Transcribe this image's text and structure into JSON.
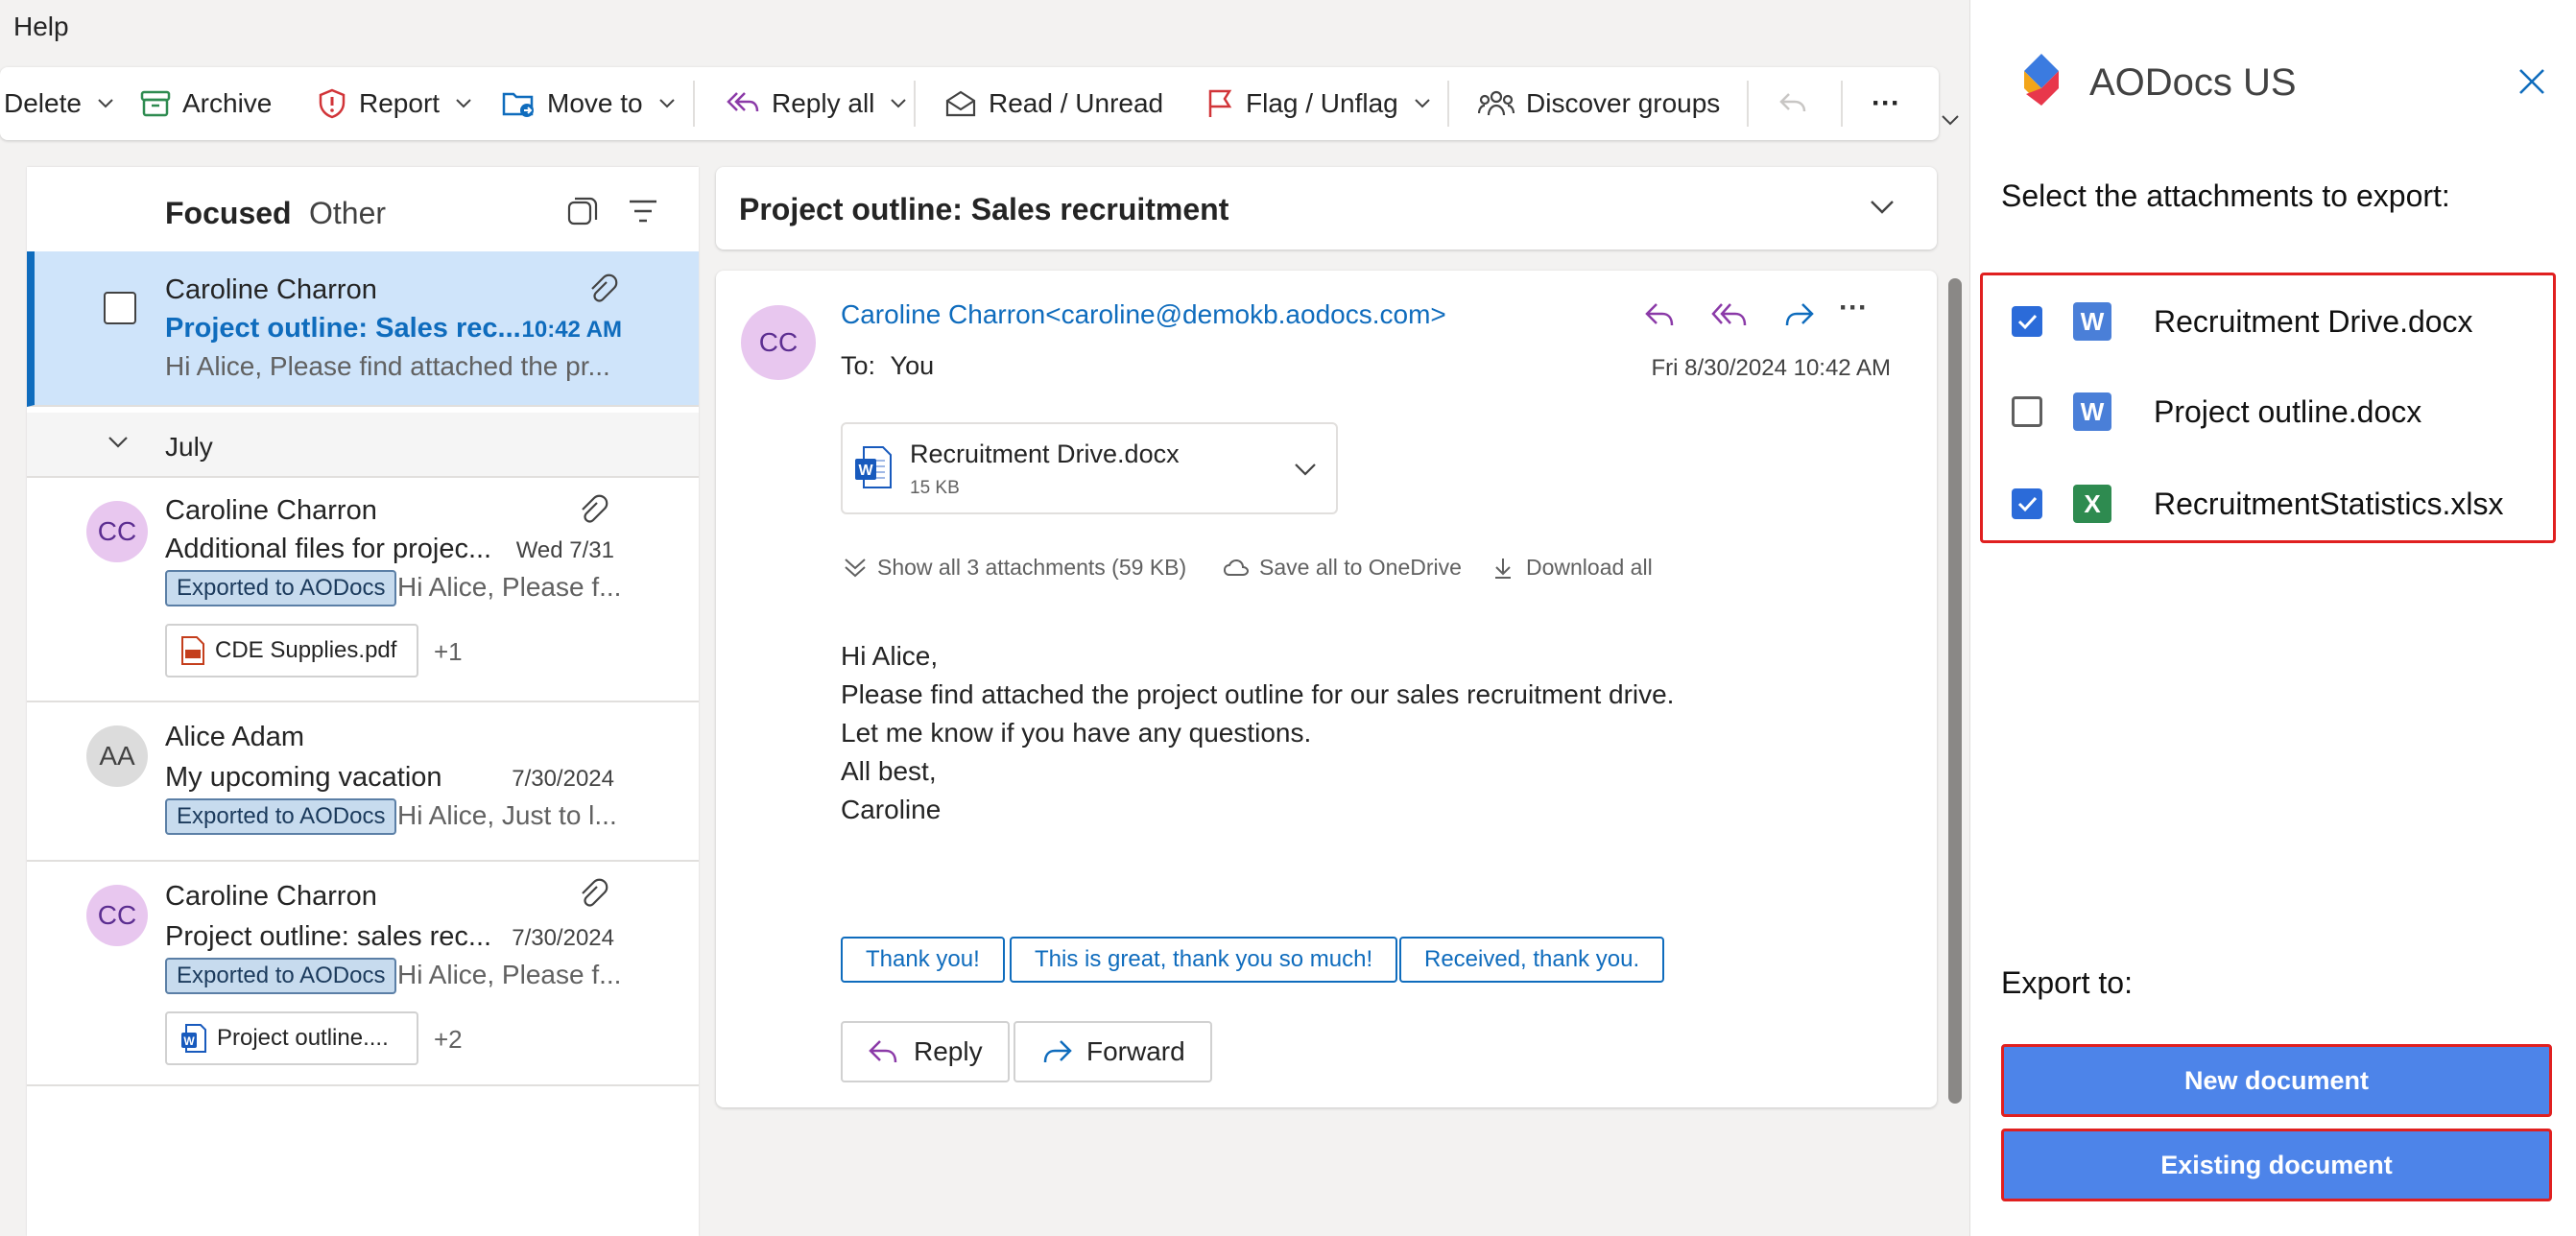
{
  "menu": {
    "help": "Help"
  },
  "ribbon": {
    "delete": "Delete",
    "archive": "Archive",
    "report": "Report",
    "move_to": "Move to",
    "reply_all": "Reply all",
    "read_unread": "Read / Unread",
    "flag_unflag": "Flag / Unflag",
    "discover_groups": "Discover groups",
    "more": "···"
  },
  "list": {
    "tabs": {
      "focused": "Focused",
      "other": "Other"
    },
    "group_label": "July",
    "items": [
      {
        "sender": "Caroline Charron",
        "subject": "Project outline: Sales rec...",
        "date": "10:42 AM",
        "preview": "Hi Alice, Please find attached the pr..."
      },
      {
        "initials": "CC",
        "sender": "Caroline Charron",
        "subject": "Additional files for projec...",
        "date": "Wed 7/31",
        "badge": "Exported to AODocs",
        "preview": "Hi Alice, Please f...",
        "attachment": "CDE Supplies.pdf",
        "more": "+1"
      },
      {
        "initials": "AA",
        "sender": "Alice Adam",
        "subject": "My upcoming vacation",
        "date": "7/30/2024",
        "badge": "Exported to AODocs",
        "preview": "Hi Alice, Just to l..."
      },
      {
        "initials": "CC",
        "sender": "Caroline Charron",
        "subject": "Project outline: sales rec...",
        "date": "7/30/2024",
        "badge": "Exported to AODocs",
        "preview": "Hi Alice, Please f...",
        "attachment": "Project outline....",
        "more": "+2"
      }
    ]
  },
  "reading": {
    "subject": "Project outline: Sales recruitment",
    "initials": "CC",
    "from": "Caroline Charron<caroline@demokb.aodocs.com>",
    "to_label": "To:",
    "to": "You",
    "date": "Fri 8/30/2024 10:42 AM",
    "attachment": {
      "name": "Recruitment Drive.docx",
      "size": "15 KB"
    },
    "show_all": "Show all 3 attachments (59 KB)",
    "save_onedrive": "Save all to OneDrive",
    "download_all": "Download all",
    "body": [
      "Hi Alice,",
      "Please find attached the project outline for our sales recruitment drive.",
      "Let me know if you have any questions.",
      "All best,",
      "Caroline"
    ],
    "suggestions": [
      "Thank you!",
      "This is great, thank you so much!",
      "Received, thank you."
    ],
    "reply": "Reply",
    "forward": "Forward"
  },
  "panel": {
    "title": "AODocs US",
    "select_label": "Select the attachments to export:",
    "files": [
      {
        "name": "Recruitment Drive.docx",
        "type": "W",
        "checked": true
      },
      {
        "name": "Project outline.docx",
        "type": "W",
        "checked": false
      },
      {
        "name": "RecruitmentStatistics.xlsx",
        "type": "X",
        "checked": true
      }
    ],
    "export_label": "Export to:",
    "new_document": "New document",
    "existing_document": "Existing document"
  },
  "colors": {
    "accent": "#0f6cbd",
    "selected_row": "#cfe4fa",
    "panel_button": "#4d84e9",
    "highlight_border": "#e02020",
    "word": "#4a7fd8",
    "excel": "#2e8b50"
  }
}
